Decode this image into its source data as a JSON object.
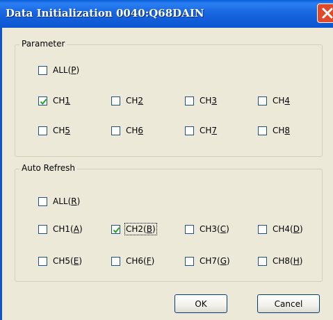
{
  "window": {
    "title": "Data Initialization 0040:Q68DAIN"
  },
  "parameter": {
    "legend": "Parameter",
    "all": {
      "text": "ALL(",
      "key": "P",
      "tail": ")",
      "checked": false
    },
    "channels": [
      {
        "text": "CH",
        "key": "1",
        "tail": "",
        "checked": true
      },
      {
        "text": "CH",
        "key": "2",
        "tail": "",
        "checked": false
      },
      {
        "text": "CH",
        "key": "3",
        "tail": "",
        "checked": false
      },
      {
        "text": "CH",
        "key": "4",
        "tail": "",
        "checked": false
      },
      {
        "text": "CH",
        "key": "5",
        "tail": "",
        "checked": false
      },
      {
        "text": "CH",
        "key": "6",
        "tail": "",
        "checked": false
      },
      {
        "text": "CH",
        "key": "7",
        "tail": "",
        "checked": false
      },
      {
        "text": "CH",
        "key": "8",
        "tail": "",
        "checked": false
      }
    ]
  },
  "auto_refresh": {
    "legend": "Auto Refresh",
    "all": {
      "text": "ALL(",
      "key": "R",
      "tail": ")",
      "checked": false
    },
    "channels": [
      {
        "text": "CH1(",
        "key": "A",
        "tail": ")",
        "checked": false
      },
      {
        "text": "CH2(",
        "key": "B",
        "tail": ")",
        "checked": true
      },
      {
        "text": "CH3(",
        "key": "C",
        "tail": ")",
        "checked": false
      },
      {
        "text": "CH4(",
        "key": "D",
        "tail": ")",
        "checked": false
      },
      {
        "text": "CH5(",
        "key": "E",
        "tail": ")",
        "checked": false
      },
      {
        "text": "CH6(",
        "key": "F",
        "tail": ")",
        "checked": false
      },
      {
        "text": "CH7(",
        "key": "G",
        "tail": ")",
        "checked": false
      },
      {
        "text": "CH8(",
        "key": "H",
        "tail": ")",
        "checked": false
      }
    ]
  },
  "buttons": {
    "ok_label": "OK",
    "cancel_label": "Cancel"
  },
  "colors": {
    "titlebar": "#0b55d0",
    "close_button": "#e04a2c",
    "dialog_background": "#ece9d8",
    "check_mark": "#21a121"
  },
  "icons": {
    "close": "close-icon",
    "check": "check-mark-icon"
  }
}
